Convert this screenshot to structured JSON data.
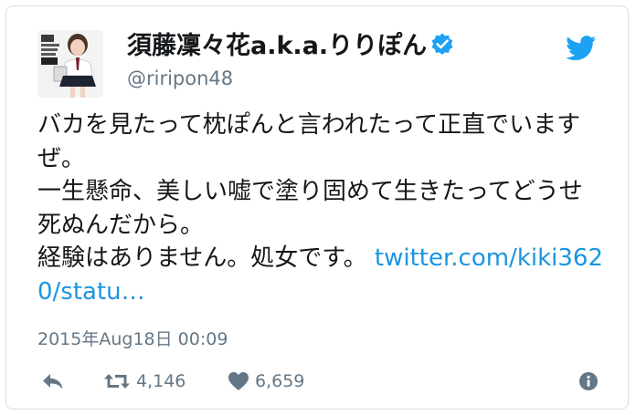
{
  "tweet": {
    "display_name": "須藤凜々花a.k.a.りりぽん",
    "handle": "@riripon48",
    "verified": true,
    "text": "バカを見たって枕ぽんと言われたって正直でいますぜ。\n一生懸命、美しい嘘で塗り固めて生きたってどうせ死ぬんだから。\n経験はありません。処女です。 ",
    "link": "twitter.com/kiki3620/statu…",
    "timestamp": "2015年Aug18日 00:09",
    "retweets": "4,146",
    "likes": "6,659"
  },
  "icons": {
    "brand": "twitter-bird-icon",
    "verified": "verified-badge-icon",
    "reply": "reply-icon",
    "retweet": "retweet-icon",
    "like": "heart-icon",
    "info": "info-icon"
  },
  "colors": {
    "brand_blue": "#1da1f2",
    "link_blue": "#1b95e0",
    "secondary_text": "#657786",
    "primary_text": "#14171a",
    "border": "#d5dde3"
  }
}
